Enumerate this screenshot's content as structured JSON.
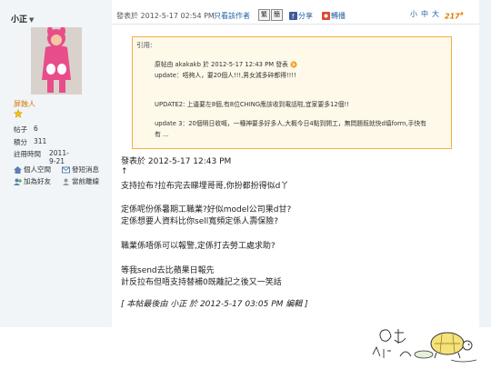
{
  "sidebar": {
    "username": "小正",
    "rank_title": "屏蝕人",
    "stats": [
      {
        "label": "帖子",
        "value": "6"
      },
      {
        "label": "積分",
        "value": "311"
      },
      {
        "label": "註冊時間",
        "value": "2011-9-21"
      }
    ],
    "links": [
      {
        "label": "個人空間",
        "icon": "home-icon"
      },
      {
        "label": "發短消息",
        "icon": "message-icon"
      },
      {
        "label": "加為好友",
        "icon": "add-friend-icon"
      },
      {
        "label": "當前離線",
        "icon": "offline-icon"
      }
    ]
  },
  "header": {
    "posted_at": "發表於 2012-5-17 02:54 PM",
    "only_author": "只看該作者",
    "trad_label": "繁",
    "simp_label": "簡",
    "share_label": "分享",
    "repost_label": "轉播",
    "font_small": "小",
    "font_medium": "中",
    "font_large": "大",
    "floor": "217"
  },
  "quote": {
    "title": "引用:",
    "author_line": "原帖由 akakakb 於 2012-5-17 12:43 PM 發表",
    "lines": [
      "update：唔夠人，要20個人!!!,男女減多碎都得!!!!",
      "",
      "UPDATE2: 上邊要左8個,有8位CHING應該收到電話啦,宜家要多12個!!",
      "",
      "update 3：20個明日收嘅，一種神要多好多人,大概今日4點到開工，無問題既就快d填form,手快有",
      "有 ..."
    ]
  },
  "post": {
    "posted_at": "發表於 2012-5-17 12:43 PM",
    "lines": [
      "↑",
      "支持拉布?拉布完去睇埋哥哥,你扮都扮得似d丫",
      "",
      "定係呢份係暑期工職業?好似model公司果d甘?",
      "定係想要人資料比你sell寬頻定係人壽保險?",
      "",
      "職業係唔係可以報警,定係打去勞工處求助?",
      "",
      "等我send去比蘋果日報先",
      "計反拉布但唔支持替補0既離記之後又一笑話"
    ],
    "edit_note": "[ 本帖最後由 小正 於 2012-5-17 03:05 PM 編輯 ]"
  },
  "colors": {
    "sidebar_bg": "#f1f5f8",
    "quote_border": "#f0b13e",
    "quote_bg": "#fff9ea",
    "rank_title": "#d27800",
    "link_blue": "#2262a8"
  }
}
